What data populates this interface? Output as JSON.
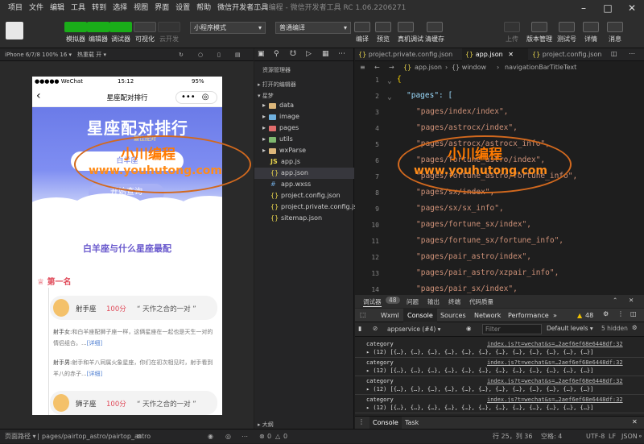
{
  "menubar": {
    "items": [
      "项目",
      "文件",
      "编辑",
      "工具",
      "转到",
      "选择",
      "视图",
      "界面",
      "设置",
      "帮助",
      "微信开发者工具"
    ],
    "window_title": "小川编程 - 微信开发者工具 RC 1.06.2206271"
  },
  "toolbar": {
    "left_buttons": [
      "模拟器",
      "编辑器",
      "调试器",
      "可视化",
      "云开发"
    ],
    "mode_select": "小程序模式",
    "compile_select": "普通编译",
    "center_buttons": [
      "编译",
      "预览",
      "真机调试",
      "清缓存"
    ],
    "right_buttons": [
      "上传",
      "版本管理",
      "测试号",
      "详情",
      "消息"
    ]
  },
  "simulator": {
    "device": "iPhone 6/7/8 100% 16 ▾",
    "hot_reload": "热重载 开 ▾",
    "status_left": "●●●●● WeChat",
    "status_time": "15:12",
    "status_battery": "95%",
    "nav_title": "星座配对排行",
    "banner_title": "星座配对排行",
    "banner_subtitle": "最佳配对",
    "input_value": "白羊座",
    "search_button": "开始查询",
    "result_heading": "白羊座与什么星座最配",
    "rank_label": "第一名",
    "entries": [
      {
        "name": "射手座",
        "score": "100分",
        "quote": "“ 天作之合的一对 ”",
        "lines": [
          {
            "who": "射手女:",
            "text": "和白羊座配狮子座一样，这俩星座在一起也是天生一对的情侣组合。...",
            "more": "[详细]"
          },
          {
            "who": "射手男:",
            "text": "射手和羊八同属火象星座，你们在初次相见时，射手看到羊八的赤子...",
            "more": "[详细]"
          }
        ]
      },
      {
        "name": "狮子座",
        "score": "100分",
        "quote": "“ 天作之合的一对 ”"
      }
    ]
  },
  "explorer": {
    "title": "资源管理器",
    "open_editors": "打开的编辑器",
    "project": "星梦",
    "items": [
      {
        "name": "data",
        "kind": "folder"
      },
      {
        "name": "image",
        "kind": "folder-img"
      },
      {
        "name": "pages",
        "kind": "folder-pg"
      },
      {
        "name": "utils",
        "kind": "folder-ut"
      },
      {
        "name": "wxParse",
        "kind": "folder"
      },
      {
        "name": "app.js",
        "kind": "js"
      },
      {
        "name": "app.json",
        "kind": "json"
      },
      {
        "name": "app.wxss",
        "kind": "wxss"
      },
      {
        "name": "project.config.json",
        "kind": "json"
      },
      {
        "name": "project.private.config.js...",
        "kind": "json"
      },
      {
        "name": "sitemap.json",
        "kind": "json"
      }
    ],
    "outline": "大纲"
  },
  "editor": {
    "tabs": [
      "project.private.config.json",
      "app.json",
      "project.config.json"
    ],
    "active_tab": "app.json",
    "breadcrumb": [
      "app.json",
      "{} window",
      "navigationBarTitleText"
    ],
    "lines": [
      {
        "n": "1",
        "text": "{"
      },
      {
        "n": "2",
        "text": "\"pages\": ["
      },
      {
        "n": "3",
        "text": "\"pages/index/index\","
      },
      {
        "n": "4",
        "text": "\"pages/astrocx/index\","
      },
      {
        "n": "5",
        "text": "\"pages/astrocx/astrocx_info\","
      },
      {
        "n": "6",
        "text": "\"pages/fortune_astro/index\","
      },
      {
        "n": "7",
        "text": "\"pages/fortune_astro/fortune_info\","
      },
      {
        "n": "8",
        "text": "\"pages/sx/index\","
      },
      {
        "n": "9",
        "text": "\"pages/sx/sx_info\","
      },
      {
        "n": "10",
        "text": "\"pages/fortune_sx/index\","
      },
      {
        "n": "11",
        "text": "\"pages/fortune_sx/fortune_info\","
      },
      {
        "n": "12",
        "text": "\"pages/pair_astro/index\","
      },
      {
        "n": "13",
        "text": "\"pages/pair_astro/xzpair_info\","
      },
      {
        "n": "14",
        "text": "\"pages/pair_sx/index\","
      }
    ]
  },
  "devtools": {
    "panel_tabs": [
      "调试器",
      "48",
      "问题",
      "输出",
      "终端",
      "代码质量"
    ],
    "tabs": [
      "Wxml",
      "Console",
      "Sources",
      "Network",
      "Performance",
      "»"
    ],
    "warn_count": "48",
    "context": "appservice (#4)",
    "filter_placeholder": "Filter",
    "levels": "Default levels ▾",
    "hidden": "5 hidden",
    "logs": [
      {
        "label": "category",
        "source": "index.js?t=wechat&s=…2aef6ef68e6448df:32",
        "value": "▸ (12) [{…}, {…}, {…}, {…}, {…}, {…}, {…}, {…}, {…}, {…}, {…}, {…}]"
      },
      {
        "label": "category",
        "source": "index.js?t=wechat&s=…2aef6ef68e6448df:32",
        "value": "▸ (12) [{…}, {…}, {…}, {…}, {…}, {…}, {…}, {…}, {…}, {…}, {…}, {…}]"
      },
      {
        "label": "category",
        "source": "index.js?t=wechat&s=…2aef6ef68e6448df:32",
        "value": "▸ (12) [{…}, {…}, {…}, {…}, {…}, {…}, {…}, {…}, {…}, {…}, {…}, {…}]"
      },
      {
        "label": "category",
        "source": "index.js?t=wechat&s=…2aef6ef68e6448df:32",
        "value": "▸ (12) [{…}, {…}, {…}, {…}, {…}, {…}, {…}, {…}, {…}, {…}, {…}, {…}]"
      }
    ],
    "bottom_tabs": [
      "Console",
      "Task"
    ]
  },
  "statusbar": {
    "path_label": "页面路径 ▾",
    "path": "pages/pairtop_astro/pairtop_astro",
    "errors": "0",
    "warnings": "0",
    "cursor": "行 25，列 36",
    "spaces": "空格: 4",
    "encoding": "UTF-8",
    "eol": "LF",
    "lang": "JSON"
  },
  "watermark": {
    "line1": "小川编程",
    "line2": "www.youhutong.com"
  }
}
